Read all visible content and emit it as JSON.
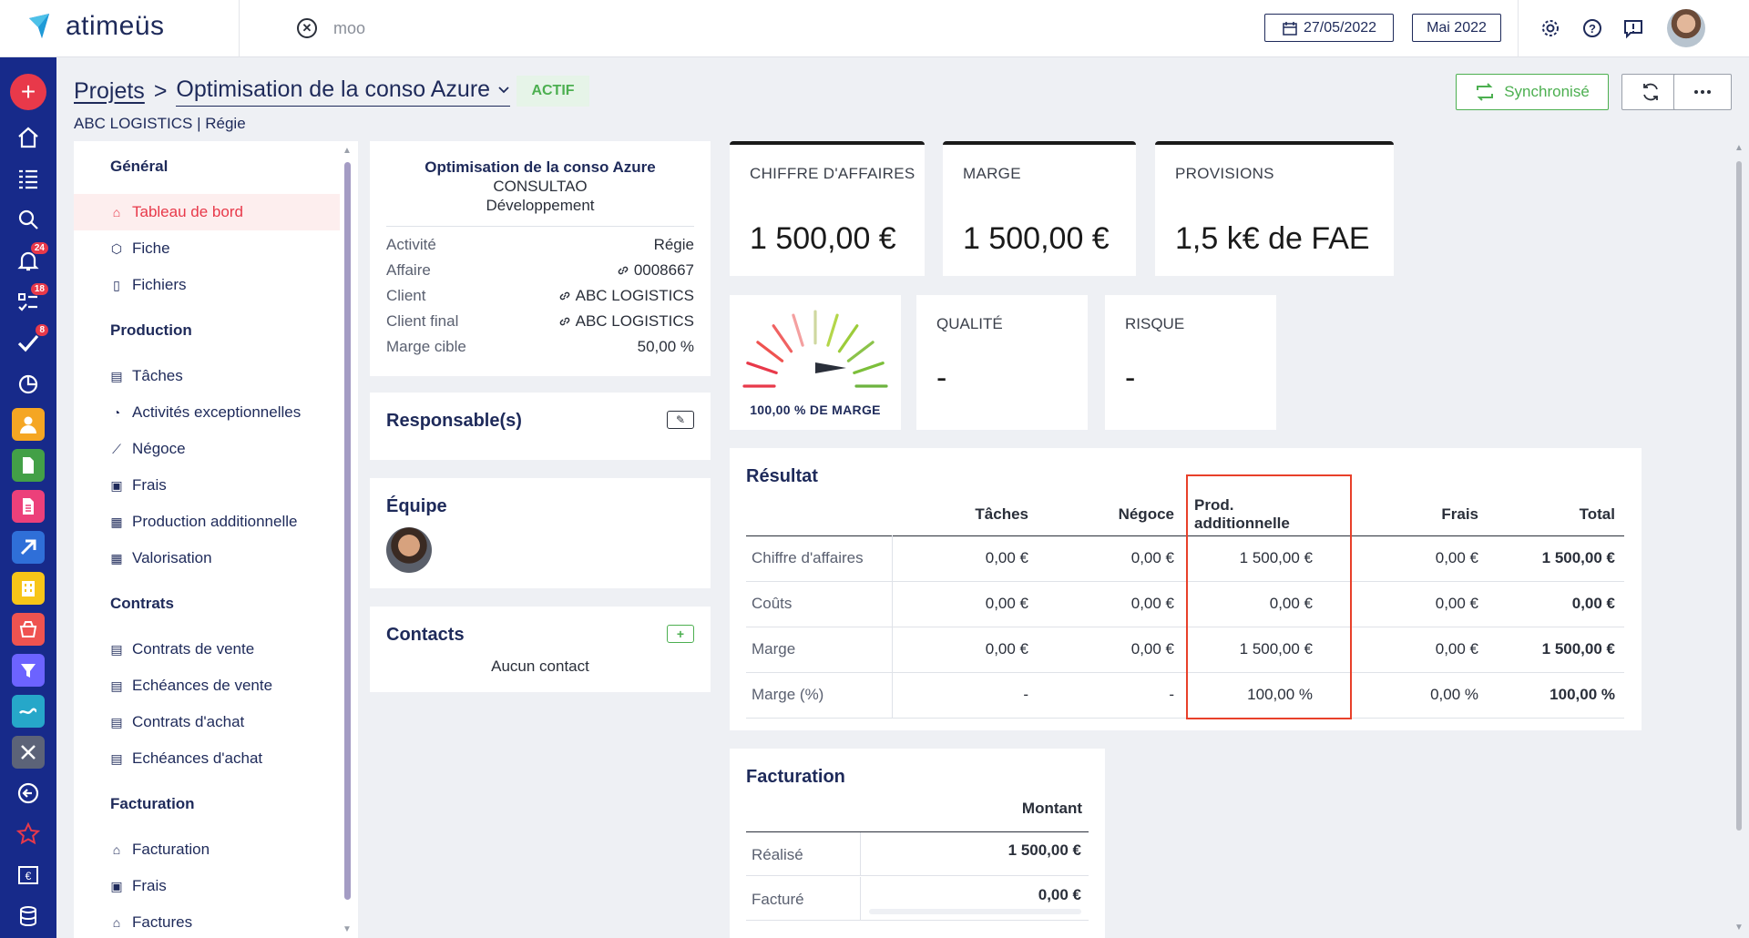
{
  "app": {
    "logo_text": "atimeüs",
    "search_value": "moo",
    "date": "27/05/2022",
    "month": "Mai 2022"
  },
  "rail": {
    "badges": {
      "notifications": "24",
      "tasks": "18",
      "checks": "8"
    }
  },
  "header": {
    "breadcrumb_root": "Projets",
    "breadcrumb_sep": ">",
    "project_title": "Optimisation de la conso Azure",
    "status": "ACTIF",
    "subtitle": "ABC LOGISTICS | Régie",
    "sync_label": "Synchronisé"
  },
  "nav": {
    "general": "Général",
    "dashboard": "Tableau de bord",
    "fiche": "Fiche",
    "fichiers": "Fichiers",
    "production": "Production",
    "taches": "Tâches",
    "activites": "Activités exceptionnelles",
    "negoce": "Négoce",
    "frais": "Frais",
    "prod_add": "Production additionnelle",
    "valorisation": "Valorisation",
    "contrats": "Contrats",
    "contrats_vente": "Contrats de vente",
    "echeances_vente": "Echéances de vente",
    "contrats_achat": "Contrats d'achat",
    "echeances_achat": "Echéances d'achat",
    "facturation": "Facturation",
    "facturation_item": "Facturation",
    "frais2": "Frais",
    "factures": "Factures"
  },
  "info": {
    "title": "Optimisation de la conso Azure",
    "line2": "CONSULTAO",
    "line3": "Développement",
    "rows": [
      {
        "k": "Activité",
        "v": "Régie"
      },
      {
        "k": "Affaire",
        "v": "0008667"
      },
      {
        "k": "Client",
        "v": "ABC LOGISTICS"
      },
      {
        "k": "Client final",
        "v": "ABC LOGISTICS"
      },
      {
        "k": "Marge cible",
        "v": "50,00 %"
      }
    ]
  },
  "cards": {
    "responsables": "Responsable(s)",
    "equipe": "Équipe",
    "contacts": "Contacts",
    "no_contact": "Aucun contact"
  },
  "kpi": {
    "ca_label": "CHIFFRE D'AFFAIRES",
    "ca_value": "1 500,00 €",
    "marge_label": "MARGE",
    "marge_value": "1 500,00 €",
    "prov_label": "PROVISIONS",
    "prov_value": "1,5 k€ de FAE",
    "gauge_caption": "100,00 % DE MARGE",
    "gauge_level_percent": 100,
    "qualite_label": "QUALITÉ",
    "qualite_value": "-",
    "risque_label": "RISQUE",
    "risque_value": "-"
  },
  "result": {
    "title": "Résultat",
    "columns": [
      "Tâches",
      "Négoce",
      "Prod. additionnelle",
      "Frais",
      "Total"
    ],
    "rows": [
      {
        "label": "Chiffre d'affaires",
        "cells": [
          "0,00 €",
          "0,00 €",
          "1 500,00 €",
          "0,00 €",
          "1 500,00 €"
        ]
      },
      {
        "label": "Coûts",
        "cells": [
          "0,00 €",
          "0,00 €",
          "0,00 €",
          "0,00 €",
          "0,00 €"
        ]
      },
      {
        "label": "Marge",
        "cells": [
          "0,00 €",
          "0,00 €",
          "1 500,00 €",
          "0,00 €",
          "1 500,00 €"
        ]
      },
      {
        "label": "Marge (%)",
        "cells": [
          "-",
          "-",
          "100,00 %",
          "0,00 %",
          "100,00 %"
        ]
      }
    ]
  },
  "facturation": {
    "title": "Facturation",
    "col": "Montant",
    "rows": [
      {
        "k": "Réalisé",
        "v": "1 500,00 €"
      },
      {
        "k": "Facturé",
        "v": "0,00 €"
      }
    ]
  },
  "colors": {
    "brand": "#172a8a",
    "accent": "#e8394a",
    "success": "#4caf50",
    "highlight": "#e8402a"
  }
}
